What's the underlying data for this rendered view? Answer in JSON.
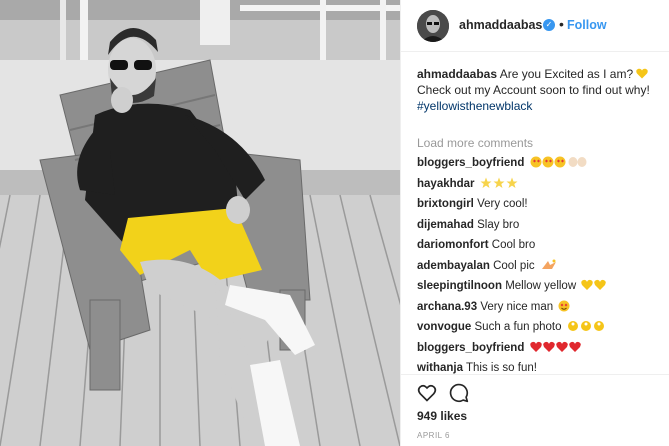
{
  "post": {
    "username": "ahmaddaabas",
    "follow_label": "Follow",
    "separator": "•",
    "caption_text": "Are you Excited as I am? 💛 Check out my Account soon to find out why!",
    "caption_pre": "Are you Excited as I am?",
    "caption_post": "Check out my Account soon to find out why!",
    "hashtag": "#yellowisthenewblack",
    "load_more": "Load more comments",
    "likes": "949 likes",
    "date": "APRIL 6"
  },
  "comments": [
    {
      "user": "bloggers_boyfriend",
      "text": "",
      "emoji": "heart-eyes-clap"
    },
    {
      "user": "hayakhdar",
      "text": "",
      "emoji": "stars"
    },
    {
      "user": "brixtongirl",
      "text": "Very cool!",
      "emoji": ""
    },
    {
      "user": "dijemahad",
      "text": "Slay bro",
      "emoji": ""
    },
    {
      "user": "dariomonfort",
      "text": "Cool bro",
      "emoji": ""
    },
    {
      "user": "adembayalan",
      "text": "Cool pic",
      "emoji": "sparkle"
    },
    {
      "user": "sleepingtilnoon",
      "text": "Mellow yellow",
      "emoji": "yellow-hearts"
    },
    {
      "user": "archana.93",
      "text": "Very nice man",
      "emoji": "heart-eyes"
    },
    {
      "user": "vonvogue",
      "text": "Such a fun photo",
      "emoji": "ok-hands"
    },
    {
      "user": "bloggers_boyfriend",
      "text": "",
      "emoji": "red-hearts"
    },
    {
      "user": "withanja",
      "text": "This is so fun!",
      "emoji": ""
    }
  ],
  "colors": {
    "link_blue": "#3897f0",
    "hashtag": "#003569",
    "shorts_yellow": "#f2d21a",
    "muted": "#999999"
  }
}
